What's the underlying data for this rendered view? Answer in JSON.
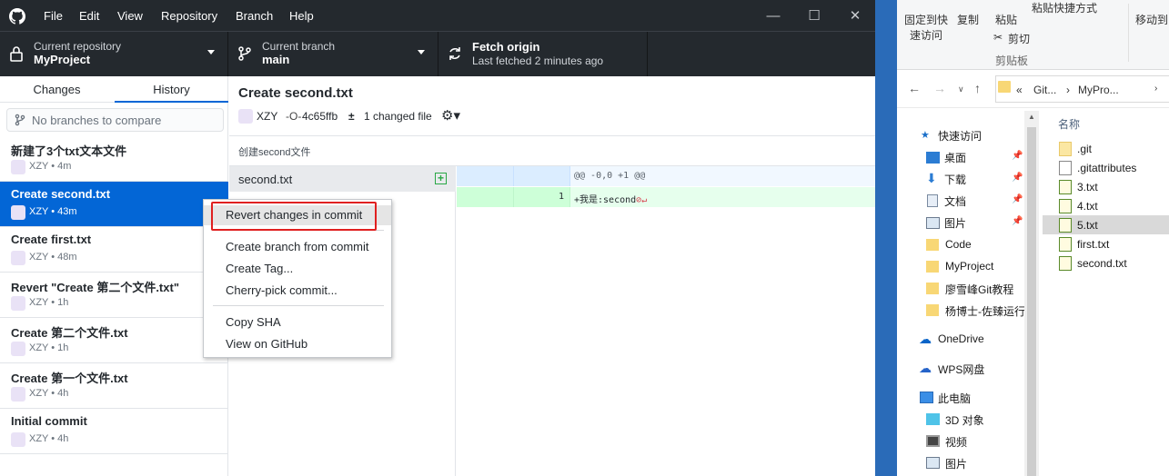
{
  "menubar": {
    "items": [
      "File",
      "Edit",
      "View",
      "Repository",
      "Branch",
      "Help"
    ]
  },
  "toolbar": {
    "repo_label": "Current repository",
    "repo_name": "MyProject",
    "branch_label": "Current branch",
    "branch_name": "main",
    "fetch_title": "Fetch origin",
    "fetch_sub": "Last fetched 2 minutes ago"
  },
  "sidebar": {
    "tabs": [
      "Changes",
      "History"
    ],
    "selected_tab": "History",
    "compare_placeholder": "No branches to compare",
    "commits": [
      {
        "title": "新建了3个txt文本文件",
        "meta": "XZY • 4m"
      },
      {
        "title": "Create second.txt",
        "meta": "XZY • 43m"
      },
      {
        "title": "Create first.txt",
        "meta": "XZY • 48m"
      },
      {
        "title": "Revert \"Create 第二个文件.txt\"",
        "meta": "XZY • 1h"
      },
      {
        "title": "Create 第二个文件.txt",
        "meta": "XZY • 1h"
      },
      {
        "title": "Create 第一个文件.txt",
        "meta": "XZY • 4h"
      },
      {
        "title": "Initial commit",
        "meta": "XZY • 4h"
      }
    ]
  },
  "commit_detail": {
    "title": "Create second.txt",
    "author": "XZY",
    "sha": "4c65ffb",
    "changed": "1 changed file",
    "description": "创建second文件",
    "file": "second.txt",
    "diff_header": "@@ -0,0 +1 @@",
    "diff_line_no": "1",
    "diff_line": "+我是:second"
  },
  "context_menu": {
    "items": [
      "Revert changes in commit",
      "Create branch from commit",
      "Create Tag...",
      "Cherry-pick commit...",
      "Copy SHA",
      "View on GitHub"
    ]
  },
  "explorer": {
    "ribbon": {
      "pin": "固定到快",
      "pin2": "速访问",
      "copy": "复制",
      "paste": "粘贴",
      "paste_shortcut": "粘贴快捷方式",
      "cut": "剪切",
      "clipboard": "剪贴板",
      "move_to": "移动到"
    },
    "address": {
      "prefix": "«",
      "part1": "Git...",
      "sep": "›",
      "part2": "MyPro..."
    },
    "nav": [
      {
        "label": "快速访问"
      },
      {
        "label": "桌面"
      },
      {
        "label": "下载"
      },
      {
        "label": "文档"
      },
      {
        "label": "图片"
      },
      {
        "label": "Code"
      },
      {
        "label": "MyProject"
      },
      {
        "label": "廖雪峰Git教程"
      },
      {
        "label": "杨博士-佐臻运行"
      },
      {
        "label": "OneDrive"
      },
      {
        "label": "WPS网盘"
      },
      {
        "label": "此电脑"
      },
      {
        "label": "3D 对象"
      },
      {
        "label": "视频"
      },
      {
        "label": "图片"
      }
    ],
    "column_header": "名称",
    "files": [
      ".git",
      ".gitattributes",
      "3.txt",
      "4.txt",
      "5.txt",
      "first.txt",
      "second.txt"
    ],
    "selected_file": "5.txt"
  }
}
